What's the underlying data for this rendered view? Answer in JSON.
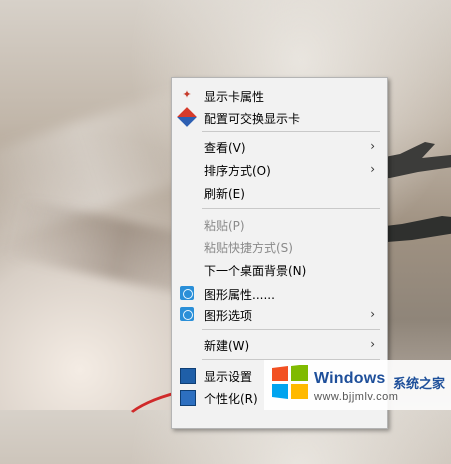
{
  "context_menu": {
    "items": [
      {
        "label": "显示卡属性",
        "icon": "graphics-card-icon",
        "disabled": false,
        "submenu": false
      },
      {
        "label": "配置可交换显示卡",
        "icon": "switchable-graphics-icon",
        "disabled": false,
        "submenu": false
      },
      {
        "label": "查看(V)",
        "icon": null,
        "disabled": false,
        "submenu": true
      },
      {
        "label": "排序方式(O)",
        "icon": null,
        "disabled": false,
        "submenu": true
      },
      {
        "label": "刷新(E)",
        "icon": null,
        "disabled": false,
        "submenu": false
      },
      {
        "label": "粘贴(P)",
        "icon": null,
        "disabled": true,
        "submenu": false
      },
      {
        "label": "粘贴快捷方式(S)",
        "icon": null,
        "disabled": true,
        "submenu": false
      },
      {
        "label": "下一个桌面背景(N)",
        "icon": null,
        "disabled": false,
        "submenu": false
      },
      {
        "label": "图形属性......",
        "icon": "intel-graphics-icon",
        "disabled": false,
        "submenu": false
      },
      {
        "label": "图形选项",
        "icon": "intel-graphics-icon",
        "disabled": false,
        "submenu": true
      },
      {
        "label": "新建(W)",
        "icon": null,
        "disabled": false,
        "submenu": true
      },
      {
        "label": "显示设置",
        "icon": "display-settings-icon",
        "disabled": false,
        "submenu": false
      },
      {
        "label": "个性化(R)",
        "icon": "personalize-icon",
        "disabled": false,
        "submenu": false
      }
    ],
    "submenu_arrow": "›"
  },
  "watermark": {
    "title": "Windows",
    "site_name": "系统之家",
    "url": "www.bjjmlv.com",
    "brand_colors": [
      "#f25022",
      "#7fba00",
      "#00a4ef",
      "#ffb900"
    ]
  }
}
